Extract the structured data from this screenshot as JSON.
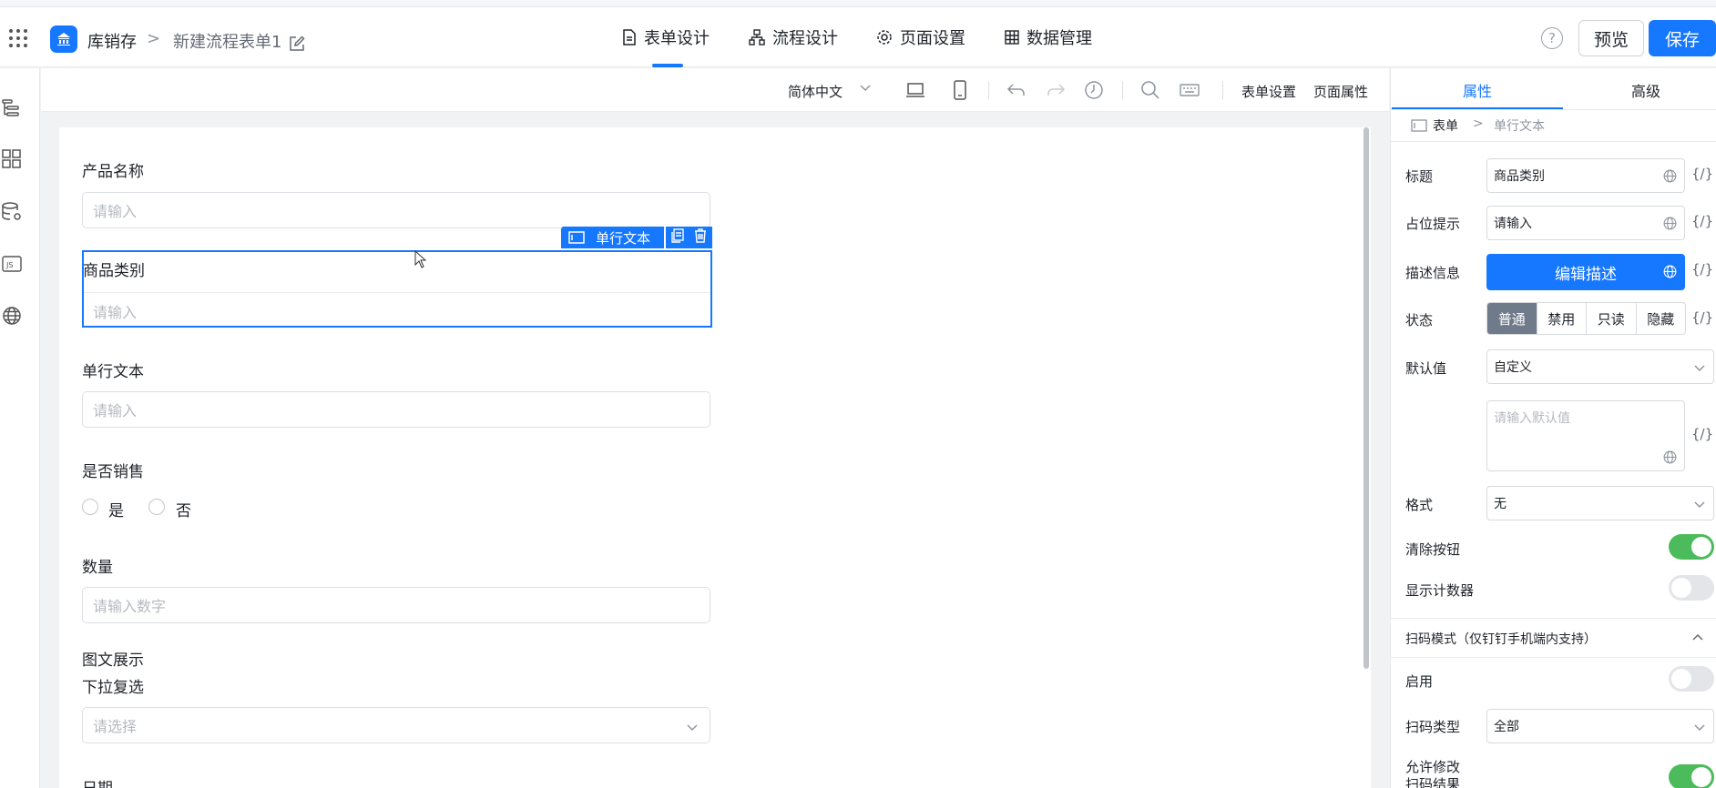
{
  "header": {
    "app_name": "库销存",
    "crumb_sep": ">",
    "form_name": "新建流程表单1",
    "nav": [
      {
        "label": "表单设计",
        "icon": "document-icon"
      },
      {
        "label": "流程设计",
        "icon": "flow-icon"
      },
      {
        "label": "页面设置",
        "icon": "gear-icon"
      },
      {
        "label": "数据管理",
        "icon": "table-icon"
      }
    ],
    "help": "?",
    "preview_label": "预览",
    "save_label": "保存",
    "accent": "#1677ff"
  },
  "toolbar": {
    "language": "简体中文",
    "form_settings": "表单设置",
    "page_props": "页面属性"
  },
  "canvas": {
    "fields": [
      {
        "label": "产品名称",
        "placeholder": "请输入"
      },
      {
        "label": "商品类别",
        "placeholder": "请输入"
      },
      {
        "label": "单行文本",
        "placeholder": "请输入"
      },
      {
        "label": "是否销售",
        "options": [
          "是",
          "否"
        ]
      },
      {
        "label": "数量",
        "placeholder": "请输入数字"
      },
      {
        "label": "图文展示"
      },
      {
        "label": "下拉复选",
        "placeholder": "请选择"
      },
      {
        "label": "日期"
      }
    ],
    "selected_tag": "单行文本"
  },
  "panel": {
    "tabs": [
      "属性",
      "高级"
    ],
    "crumb": [
      "表单",
      "单行文本"
    ],
    "title_label": "标题",
    "title_value": "商品类别",
    "placeholder_label": "占位提示",
    "placeholder_value": "请输入",
    "desc_label": "描述信息",
    "desc_button": "编辑描述",
    "status_label": "状态",
    "status_options": [
      "普通",
      "禁用",
      "只读",
      "隐藏"
    ],
    "default_label": "默认值",
    "default_value": "自定义",
    "default_placeholder": "请输入默认值",
    "format_label": "格式",
    "format_value": "无",
    "clear_button_label": "清除按钮",
    "clear_button_on": true,
    "counter_label": "显示计数器",
    "counter_on": false,
    "scan_section": "扫码模式（仅钉钉手机端内支持）",
    "enable_label": "启用",
    "enable_on": false,
    "scan_type_label": "扫码类型",
    "scan_type_value": "全部",
    "allow_edit_label": "允许修改扫码结果",
    "allow_edit_on": true,
    "expr": "{/}"
  }
}
